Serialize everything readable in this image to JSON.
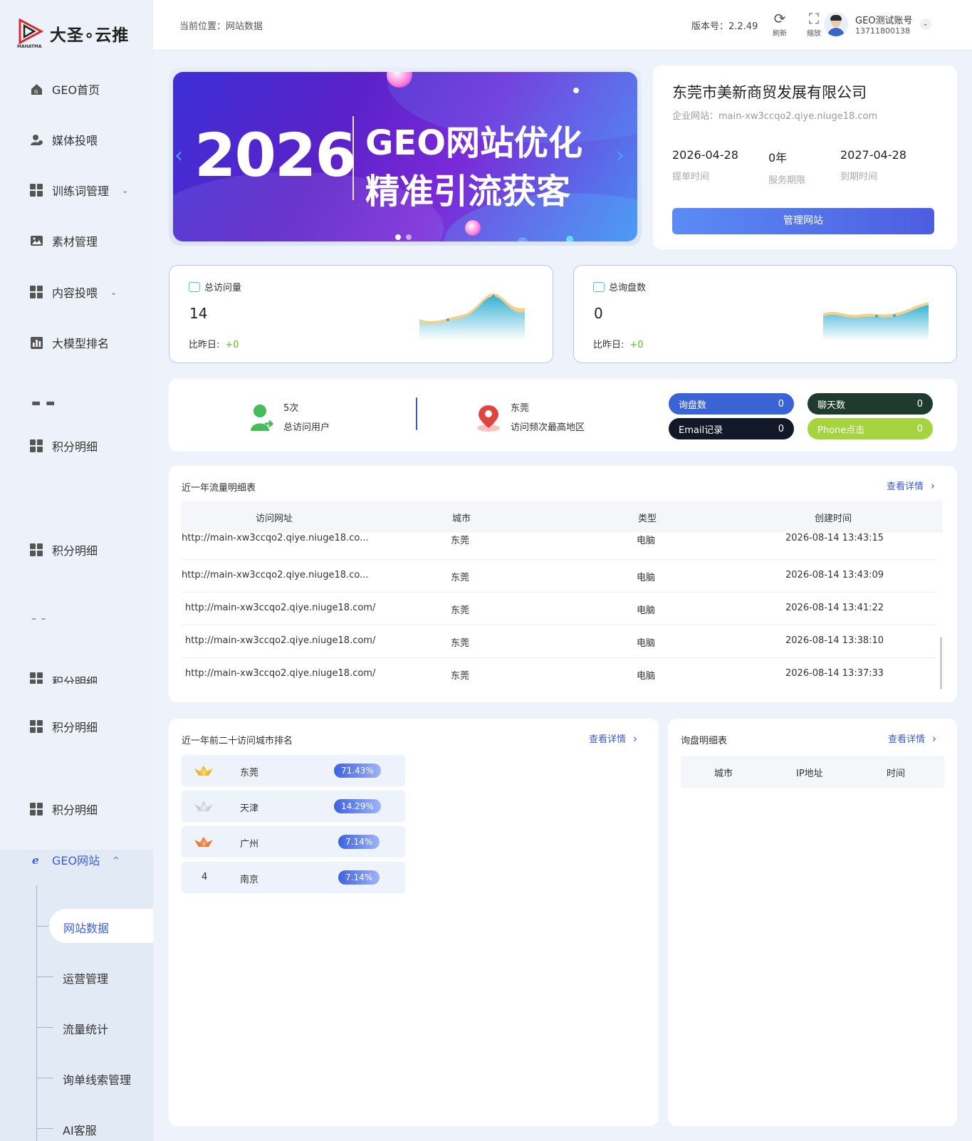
{
  "brand": {
    "name": "大圣∘云推",
    "sub": "MAHATMA"
  },
  "sidebar": {
    "items": [
      {
        "label": "GEO首页",
        "icon": "home-icon"
      },
      {
        "label": "媒体投喂",
        "icon": "user-icon"
      },
      {
        "label": "训练词管理",
        "icon": "grid-icon",
        "chevron": "⌄"
      },
      {
        "label": "素材管理",
        "icon": "image-icon"
      },
      {
        "label": "内容投喂",
        "icon": "grid-icon",
        "chevron": "⌄"
      },
      {
        "label": "大模型排名",
        "icon": "bar-chart-icon"
      },
      {
        "label": "积分明细",
        "icon": "grid-icon"
      },
      {
        "label": "积分明细",
        "icon": "grid-icon"
      },
      {
        "label": "积分明细",
        "icon": "grid-icon"
      },
      {
        "label": "积分明细",
        "icon": "grid-icon"
      },
      {
        "label": "积分明细",
        "icon": "grid-icon"
      }
    ],
    "dashes": [
      "▬ ▬",
      "– –"
    ],
    "active_group": {
      "label": "GEO网站",
      "icon": "ie-icon",
      "chevron": "^"
    },
    "sub_items": [
      "网站数据",
      "运营管理",
      "流量统计",
      "询单线索管理",
      "AI客服"
    ]
  },
  "topbar": {
    "breadcrumb": "当前位置：网站数据",
    "version": "版本号：2.2.49",
    "refresh_label": "刷新",
    "zoom_label": "缩放",
    "user_name": "GEO测试账号",
    "user_phone": "13711800138"
  },
  "banner": {
    "year": "2026",
    "line1": "GEO网站优化",
    "line2": "精准引流获客"
  },
  "company": {
    "name": "东莞市美新商贸发展有限公司",
    "site": "企业网站：main-xw3ccqo2.qiye.niuge18.com",
    "submit_date": "2026-04-28",
    "submit_label": "提单时间",
    "service_period": "0年",
    "service_label": "服务期限",
    "expire_date": "2027-04-28",
    "expire_label": "到期时间",
    "manage_button": "管理网站"
  },
  "stats": [
    {
      "title": "总访问量",
      "value": "14",
      "compare_label": "比昨日:",
      "compare_value": "+0"
    },
    {
      "title": "总询盘数",
      "value": "0",
      "compare_label": "比昨日:",
      "compare_value": "+0"
    }
  ],
  "summary": {
    "visits": "5次",
    "visits_label": "总访问用户",
    "top_city": "东莞",
    "top_city_label": "访问频次最高地区",
    "pills": [
      {
        "label": "询盘数",
        "value": "0",
        "color": "#3a63d6"
      },
      {
        "label": "聊天数",
        "value": "0",
        "color": "#1f3a2e"
      },
      {
        "label": "Email记录",
        "value": "0",
        "color": "#111827"
      },
      {
        "label": "Phone点击",
        "value": "0",
        "color": "#a6d43f"
      }
    ]
  },
  "traffic": {
    "title": "近一年流量明细表",
    "more": "查看详情",
    "columns": [
      "访问网址",
      "城市",
      "类型",
      "创建时间"
    ],
    "rows": [
      [
        "http://main-xw3ccqo2.qiye.niuge18.co...",
        "东莞",
        "电脑",
        "2026-08-14 13:43:15"
      ],
      [
        "http://main-xw3ccqo2.qiye.niuge18.co...",
        "东莞",
        "电脑",
        "2026-08-14 13:43:09"
      ],
      [
        "http://main-xw3ccqo2.qiye.niuge18.com/",
        "东莞",
        "电脑",
        "2026-08-14 13:41:22"
      ],
      [
        "http://main-xw3ccqo2.qiye.niuge18.com/",
        "东莞",
        "电脑",
        "2026-08-14 13:38:10"
      ],
      [
        "http://main-xw3ccqo2.qiye.niuge18.com/",
        "东莞",
        "电脑",
        "2026-08-14 13:37:33"
      ]
    ]
  },
  "city_rank": {
    "title": "近一年前二十访问城市排名",
    "more": "查看详情",
    "rows": [
      {
        "rank": "1",
        "city": "东莞",
        "pct": "71.43%",
        "medal": "gold-medal-icon"
      },
      {
        "rank": "2",
        "city": "天津",
        "pct": "14.29%",
        "medal": "silver-medal-icon"
      },
      {
        "rank": "3",
        "city": "广州",
        "pct": "7.14%",
        "medal": "bronze-medal-icon"
      },
      {
        "rank": "4",
        "city": "南京",
        "pct": "7.14%",
        "medal": ""
      }
    ]
  },
  "inquiry": {
    "title": "询盘明细表",
    "more": "查看详情",
    "columns": [
      "城市",
      "IP地址",
      "时间"
    ]
  }
}
